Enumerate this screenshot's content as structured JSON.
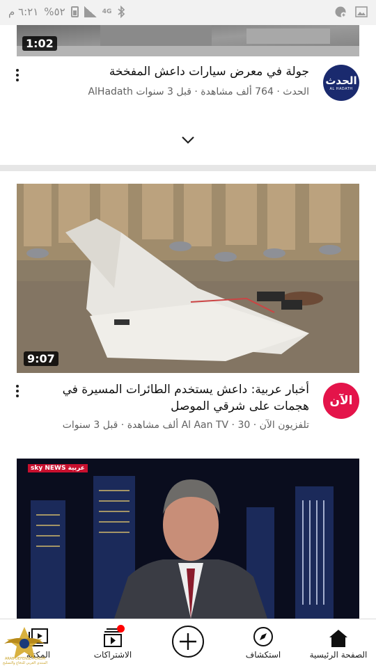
{
  "status_bar": {
    "time": "٦:٢١ م",
    "battery": "%٥٢",
    "network": "4G"
  },
  "videos": [
    {
      "duration": "1:02",
      "title": "جولة في معرض سيارات داعش المفخخة",
      "channel": "الحدث",
      "channel_latin": "AlHadath",
      "views": "764 ألف مشاهدة",
      "age": "قبل 3 سنوات",
      "avatar_text": "الحدث",
      "avatar_sub": "AL HADATH"
    },
    {
      "duration": "9:07",
      "title": "أخبار عربية: داعش يستخدم الطائرات المسيرة في هجمات على شرقي الموصل",
      "channel": "تلفزيون الآن",
      "channel_latin": "Al Aan TV",
      "views": "30 ألف مشاهدة",
      "age": "قبل 3 سنوات",
      "avatar_text": "الآن"
    },
    {
      "brand": "sky NEWS عربية"
    }
  ],
  "bottom_nav": {
    "home": "الصفحة الرئيسية",
    "explore": "استكشاف",
    "subscriptions": "الاشتراكات",
    "library": "المكتبة"
  },
  "watermark": {
    "name": "ARAB DEFENSE FORUM",
    "tagline": "المنتدى العربي للدفاع والتسليح"
  },
  "colors": {
    "alhadath_avatar": "#1a2a6e",
    "alaan_avatar": "#e4144a",
    "notification_dot": "#ff0000"
  }
}
